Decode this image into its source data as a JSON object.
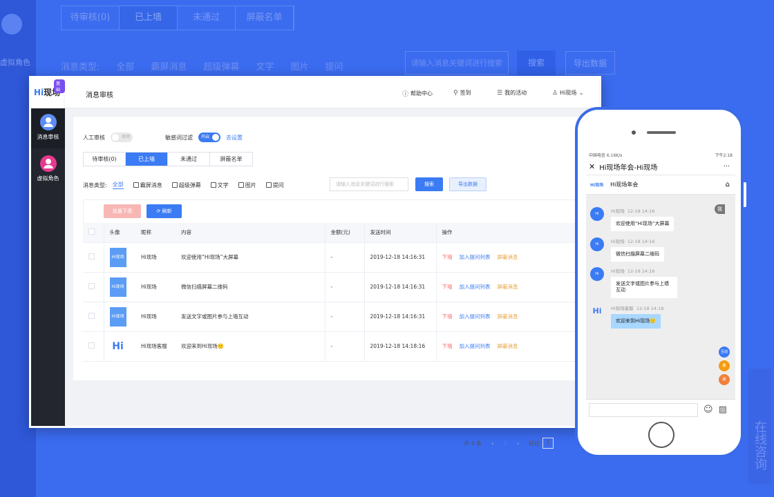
{
  "background": {
    "side_label": "虚拟角色",
    "tabs": [
      "待审核(0)",
      "已上墙",
      "未通过",
      "屏蔽名单"
    ],
    "filter": [
      "消息类型:",
      "全部",
      "霸屏消息",
      "超级弹幕",
      "文字",
      "图片",
      "提问"
    ],
    "search_placeholder": "请输入消息关键词进行搜索",
    "search_label": "搜索",
    "export_label": "导出数据",
    "consult_label": "在线咨询"
  },
  "app": {
    "logo_hi": "Hi",
    "logo_text": "现场",
    "logo_badge": "基础",
    "page_title": "消息审核",
    "nav": [
      {
        "label": "消息审核"
      },
      {
        "label": "虚拟角色"
      }
    ],
    "top_links": {
      "help": "帮助中心",
      "checkin": "签到",
      "activities": "我的活动",
      "user": "Hi现场"
    },
    "switches": {
      "manual_label": "人工审核",
      "manual_state": "关闭",
      "sensitive_label": "敏感词过滤",
      "sensitive_state": "开启",
      "sensitive_link": "去设置"
    },
    "tabs": [
      "待审核(0)",
      "已上墙",
      "未通过",
      "屏蔽名单"
    ],
    "filter": {
      "label": "消息类型:",
      "items": [
        "全部",
        "霸屏消息",
        "超级弹幕",
        "文字",
        "图片",
        "提问"
      ]
    },
    "search_placeholder": "请输入消息关键词进行搜索",
    "search_button": "搜索",
    "export_button": "导出数据",
    "batch_button": "批量下墙",
    "refresh_button": "刷新",
    "table": {
      "headers": [
        "头像",
        "昵称",
        "内容",
        "金额(元)",
        "发送时间",
        "操作"
      ],
      "rows": [
        {
          "avatar": "Hi现场",
          "nickname": "Hi现场",
          "content": "欢迎使用“Hi现场”大屏幕",
          "amount": "-",
          "time": "2019-12-18 14:16:31"
        },
        {
          "avatar": "Hi现场",
          "nickname": "Hi现场",
          "content": "微信扫描屏幕二维码",
          "amount": "-",
          "time": "2019-12-18 14:16:31"
        },
        {
          "avatar": "Hi现场",
          "nickname": "Hi现场",
          "content": "发送文字或图片参与上墙互动",
          "amount": "-",
          "time": "2019-12-18 14:16:31"
        },
        {
          "avatar": "Hi",
          "nickname": "Hi现场客服",
          "content": "欢迎来到Hi现场🙂",
          "amount": "-",
          "time": "2019-12-18 14:18:16"
        }
      ],
      "actions": [
        "下墙",
        "加入提问列表",
        "屏蔽消息"
      ]
    },
    "pager": {
      "total": "共 4 条",
      "current": "1",
      "goto_label": "前往",
      "goto_value": "1"
    }
  },
  "phone": {
    "status_left": "中国电信 6.16K/s",
    "status_right": "下午2:18",
    "title": "Hi现场年会-Hi现场",
    "subtitle": "Hi现场年会",
    "mini_logo": "Hi现场",
    "me_tag": "我",
    "messages": [
      {
        "sender": "Hi现场",
        "time": "12-18 14:16",
        "text": "欢迎使用“Hi现场”大屏幕"
      },
      {
        "sender": "Hi现场",
        "time": "12-18 14:16",
        "text": "微信扫描屏幕二维码"
      },
      {
        "sender": "Hi现场",
        "time": "12-18 14:16",
        "text": "发送文字或图片参与上墙互动"
      },
      {
        "sender": "Hi现场客服",
        "time": "12-18 14:18",
        "text": "欢迎来到Hi现场🙂"
      }
    ],
    "side_buttons": [
      "互动",
      "霸",
      "弹"
    ]
  },
  "colors": {
    "accent": "#3b7bf3",
    "danger": "#f56c6c",
    "warning": "#e6a23c",
    "background": "#3b6cf0"
  }
}
